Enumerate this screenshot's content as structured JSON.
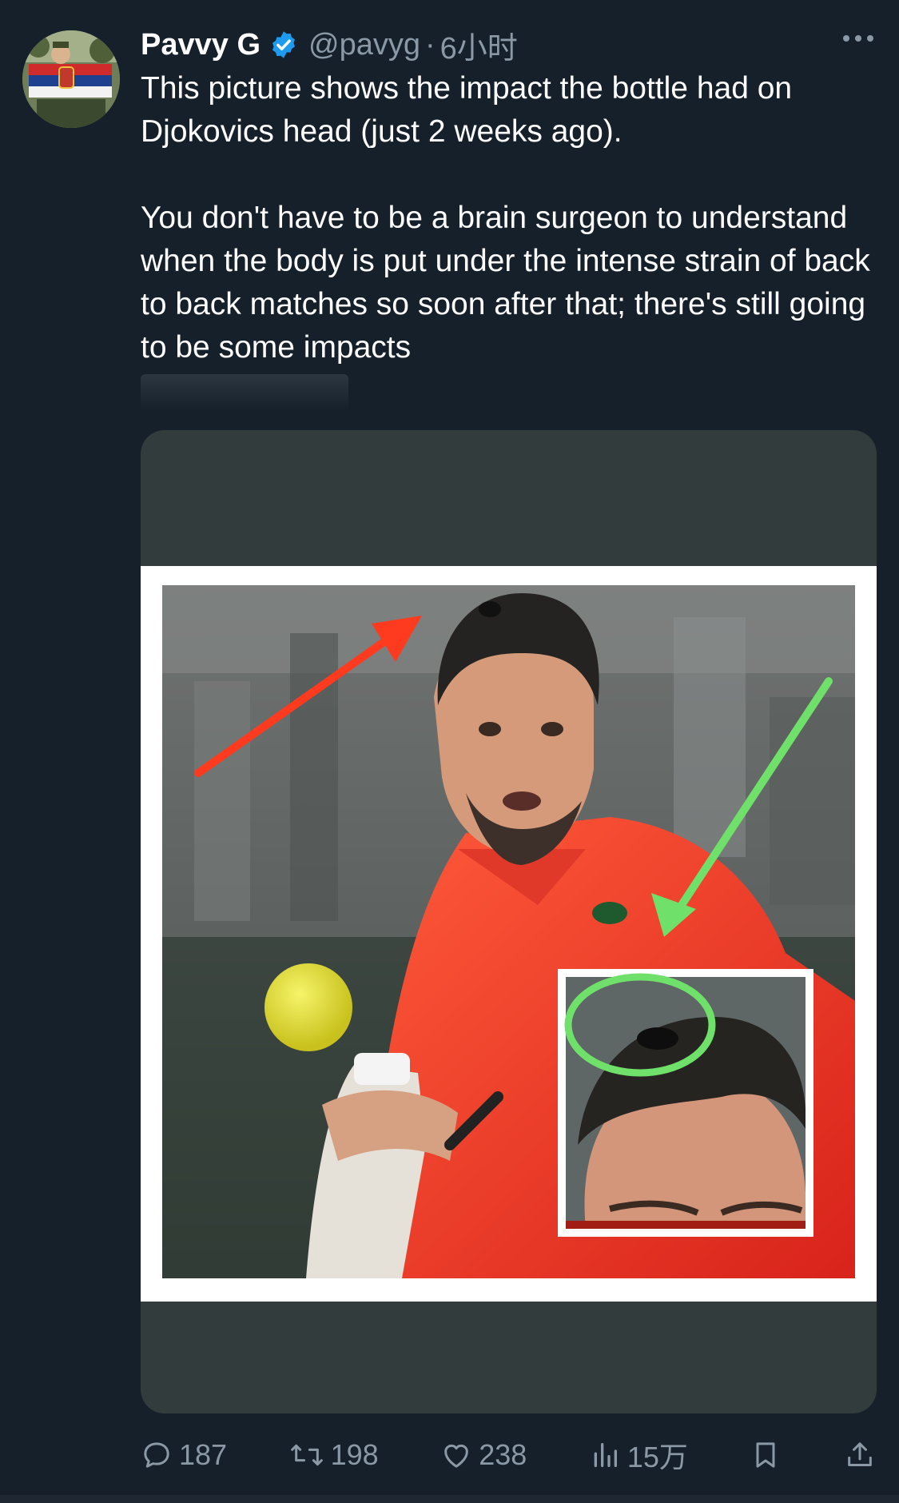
{
  "author": {
    "name": "Pavvy G",
    "handle": "@pavyg",
    "separator": "·",
    "time": "6小时",
    "verified": true
  },
  "tweet": {
    "paragraph_1": "This picture shows the impact the bottle had on Djokovics head (just 2 weeks ago).",
    "paragraph_2": "You don't have to be a brain surgeon to understand when the body is put under the intense strain of back to back matches so soon after that; there's still going to be some impacts"
  },
  "actions": {
    "replies": "187",
    "retweets": "198",
    "likes": "238",
    "views": "15万"
  },
  "colors": {
    "background": "#15202b",
    "muted_text": "#8b98a5",
    "verified_blue": "#1d9bf0",
    "arrow_red": "#ff3b1f",
    "arrow_green": "#6fe06a"
  },
  "icons": {
    "verified": "verified-badge-icon",
    "more": "more-options-icon",
    "reply": "reply-icon",
    "retweet": "retweet-icon",
    "like": "heart-icon",
    "views": "views-chart-icon",
    "bookmark": "bookmark-icon",
    "share": "share-icon"
  }
}
